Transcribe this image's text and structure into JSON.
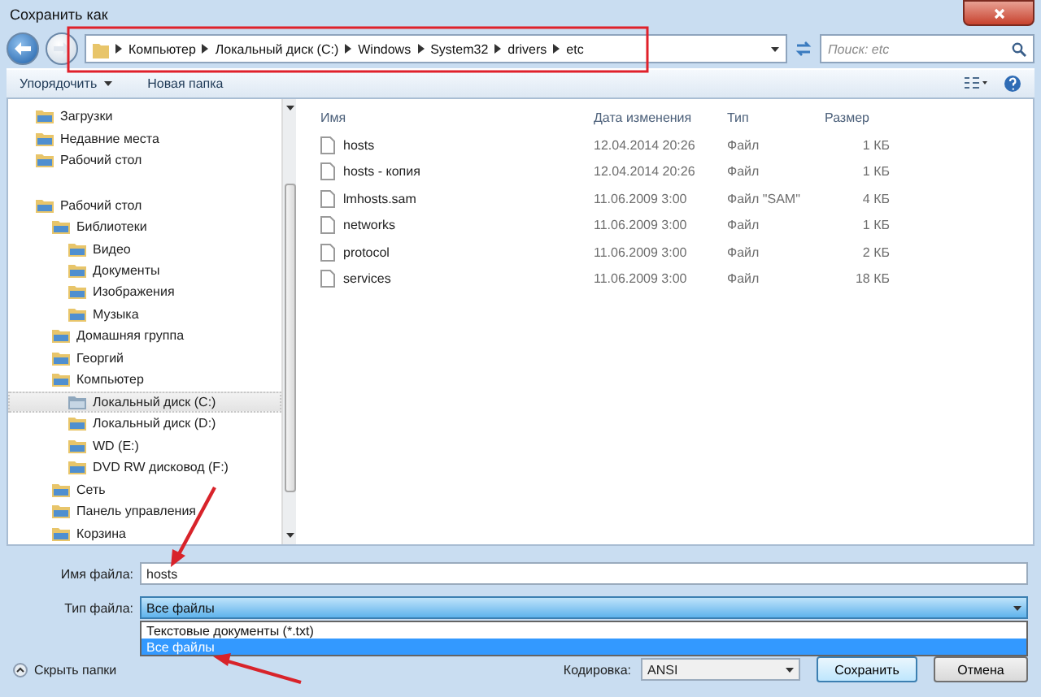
{
  "window": {
    "title": "Сохранить как"
  },
  "address": {
    "path": [
      "Компьютер",
      "Локальный диск (C:)",
      "Windows",
      "System32",
      "drivers",
      "etc"
    ]
  },
  "search": {
    "placeholder": "Поиск: etc"
  },
  "toolbar": {
    "buttons": [
      {
        "label": "Упорядочить",
        "has_menu": true
      },
      {
        "label": "Новая папка",
        "has_menu": false
      }
    ]
  },
  "nav": {
    "groups": [
      {
        "items": [
          {
            "label": "Загрузки",
            "selected": false
          },
          {
            "label": "Недавние места",
            "selected": false
          },
          {
            "label": "Рабочий стол",
            "selected": false
          }
        ]
      },
      {
        "items": [
          {
            "label": "Рабочий стол",
            "selected": false,
            "children": [
              {
                "label": "Библиотеки",
                "selected": false,
                "children": [
                  {
                    "label": "Видео",
                    "selected": false
                  },
                  {
                    "label": "Документы",
                    "selected": false
                  },
                  {
                    "label": "Изображения",
                    "selected": false
                  },
                  {
                    "label": "Музыка",
                    "selected": false
                  }
                ]
              },
              {
                "label": "Домашняя группа",
                "selected": false
              },
              {
                "label": "Георгий",
                "selected": false
              },
              {
                "label": "Компьютер",
                "selected": false,
                "children": [
                  {
                    "label": "Локальный диск (C:)",
                    "selected": true
                  },
                  {
                    "label": "Локальный диск (D:)",
                    "selected": false
                  },
                  {
                    "label": "WD (E:)",
                    "selected": false
                  },
                  {
                    "label": "DVD RW дисковод (F:)",
                    "selected": false
                  }
                ]
              },
              {
                "label": "Сеть",
                "selected": false
              },
              {
                "label": "Панель управления",
                "selected": false
              },
              {
                "label": "Корзина",
                "selected": false
              }
            ]
          }
        ]
      }
    ]
  },
  "files": {
    "columns": [
      "Имя",
      "Дата изменения",
      "Тип",
      "Размер"
    ],
    "rows": [
      {
        "name": "hosts",
        "date": "12.04.2014 20:26",
        "type": "Файл",
        "size": "1 КБ"
      },
      {
        "name": "hosts - копия",
        "date": "12.04.2014 20:26",
        "type": "Файл",
        "size": "1 КБ"
      },
      {
        "name": "lmhosts.sam",
        "date": "11.06.2009 3:00",
        "type": "Файл \"SAM\"",
        "size": "4 КБ"
      },
      {
        "name": "networks",
        "date": "11.06.2009 3:00",
        "type": "Файл",
        "size": "1 КБ"
      },
      {
        "name": "protocol",
        "date": "11.06.2009 3:00",
        "type": "Файл",
        "size": "2 КБ"
      },
      {
        "name": "services",
        "date": "11.06.2009 3:00",
        "type": "Файл",
        "size": "18 КБ"
      }
    ]
  },
  "form": {
    "filename_label": "Имя файла:",
    "filename": "hosts",
    "filetype_label": "Тип файла:",
    "filetype": "Все файлы",
    "filetype_options": [
      {
        "label": "Текстовые документы (*.txt)",
        "selected": false
      },
      {
        "label": "Все файлы",
        "selected": true
      }
    ],
    "hide_folders": "Скрыть папки",
    "encoding_label": "Кодировка:",
    "encoding": "ANSI"
  },
  "buttons": [
    "Сохранить",
    "Отмена"
  ]
}
